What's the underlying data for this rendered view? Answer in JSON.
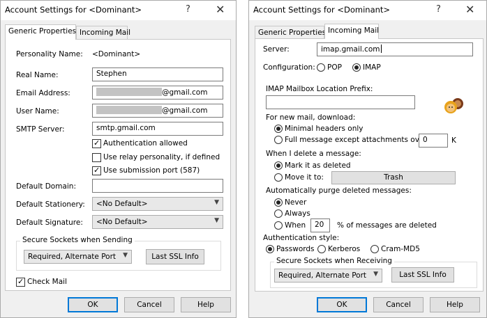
{
  "left": {
    "title": "Account Settings for <Dominant>",
    "help_glyph": "?",
    "close_glyph": "✕",
    "tabs": [
      "Generic Properties",
      "Incoming Mail"
    ],
    "personality_label": "Personality Name:",
    "personality_value": "<Dominant>",
    "real_name_label": "Real Name:",
    "real_name_value": "Stephen",
    "email_label": "Email Address:",
    "email_suffix": "@gmail.com",
    "username_label": "User Name:",
    "username_suffix": "@gmail.com",
    "smtp_label": "SMTP Server:",
    "smtp_value": "smtp.gmail.com",
    "auth_allowed_label": "Authentication allowed",
    "auth_allowed_checked": true,
    "relay_label": "Use relay personality, if defined",
    "relay_checked": false,
    "submission_label": "Use submission port (587)",
    "submission_checked": true,
    "domain_label": "Default Domain:",
    "domain_value": "",
    "stationery_label": "Default Stationery:",
    "stationery_value": "<No Default>",
    "signature_label": "Default Signature:",
    "signature_value": "<No Default>",
    "ssl_group_label": "Secure Sockets when Sending",
    "ssl_value": "Required, Alternate Port",
    "last_ssl_label": "Last SSL Info",
    "check_mail_label": "Check Mail",
    "check_mail_checked": true,
    "ok_label": "OK",
    "cancel_label": "Cancel",
    "help_label": "Help"
  },
  "right": {
    "title": "Account Settings for <Dominant>",
    "help_glyph": "?",
    "close_glyph": "✕",
    "tabs": [
      "Generic Properties",
      "Incoming Mail"
    ],
    "server_label": "Server:",
    "server_value": "imap.gmail.com",
    "config_label": "Configuration:",
    "config_options": [
      "POP",
      "IMAP"
    ],
    "config_selected": "IMAP",
    "prefix_label": "IMAP Mailbox Location Prefix:",
    "prefix_value": "",
    "download_label": "For new mail, download:",
    "download_options": [
      "Minimal headers only",
      "Full message except attachments over"
    ],
    "download_selected": "Minimal headers only",
    "size_value": "0",
    "size_unit": "K",
    "delete_label": "When I delete a message:",
    "delete_options": [
      "Mark it as deleted",
      "Move it to:"
    ],
    "delete_selected": "Mark it as deleted",
    "trash_label": "Trash",
    "purge_label": "Automatically purge deleted messages:",
    "purge_options": [
      "Never",
      "Always",
      "When"
    ],
    "purge_selected": "Never",
    "purge_percent": "20",
    "purge_suffix": "% of messages are deleted",
    "auth_label": "Authentication style:",
    "auth_options": [
      "Passwords",
      "Kerberos",
      "Cram-MD5"
    ],
    "auth_selected": "Passwords",
    "ssl_group_label": "Secure Sockets when Receiving",
    "ssl_value": "Required, Alternate Port",
    "last_ssl_label": "Last SSL Info",
    "ok_label": "OK",
    "cancel_label": "Cancel",
    "help_label": "Help"
  }
}
